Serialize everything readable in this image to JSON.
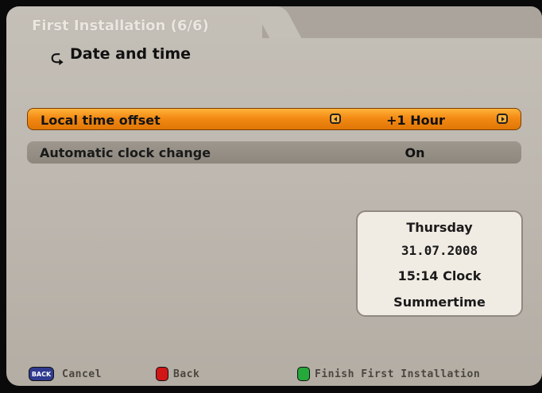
{
  "header": {
    "title": "First Installation (6/6)",
    "subtitle": "Date and time",
    "subtitle_icon": "redo-arrow-icon"
  },
  "settings": [
    {
      "label": "Local time offset",
      "value": "+1 Hour",
      "selected": true
    },
    {
      "label": "Automatic clock change",
      "value": "On",
      "selected": false
    }
  ],
  "info": {
    "day": "Thursday",
    "date": "31.07.2008",
    "time": "15:14 Clock",
    "note": "Summertime"
  },
  "footer": {
    "cancel_key": "BACK",
    "cancel_label": "Cancel",
    "back_label": "Back",
    "finish_label": "Finish First Installation"
  },
  "colors": {
    "selected_row": "#f38a14",
    "normal_row": "#8d877e",
    "panel": "#c4bfb7",
    "red_key": "#d11616",
    "green_key": "#25a93a"
  }
}
